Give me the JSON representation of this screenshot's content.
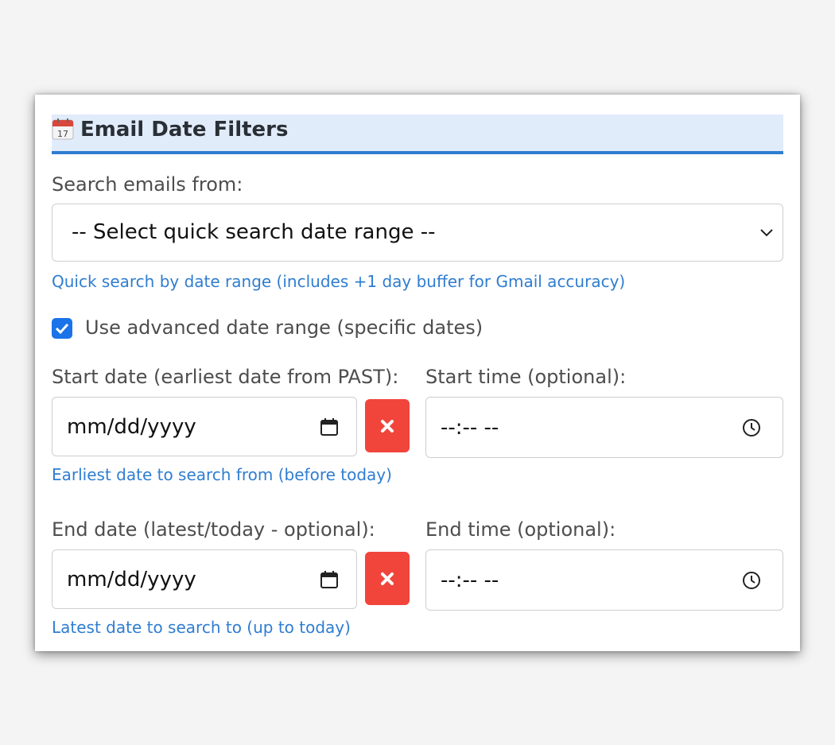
{
  "header": {
    "title": "Email Date Filters",
    "icon": "calendar-icon"
  },
  "quick_search": {
    "label": "Search emails from:",
    "selected": "-- Select quick search date range --",
    "hint": "Quick search by date range (includes +1 day buffer for Gmail accuracy)"
  },
  "advanced": {
    "checked": true,
    "label": "Use advanced date range (specific dates)"
  },
  "start": {
    "date_label": "Start date (earliest date from PAST):",
    "date_value": "mm/dd/yyyy",
    "time_label": "Start time (optional):",
    "time_value": "--:-- --",
    "hint": "Earliest date to search from (before today)"
  },
  "end": {
    "date_label": "End date (latest/today - optional):",
    "date_value": "mm/dd/yyyy",
    "time_label": "End time (optional):",
    "time_value": "--:-- --",
    "hint": "Latest date to search to (up to today)"
  },
  "colors": {
    "accent": "#2f7dd1",
    "header_bg": "#e1ecfb",
    "clear_button": "#f1453b",
    "checkbox": "#1a73e8"
  }
}
